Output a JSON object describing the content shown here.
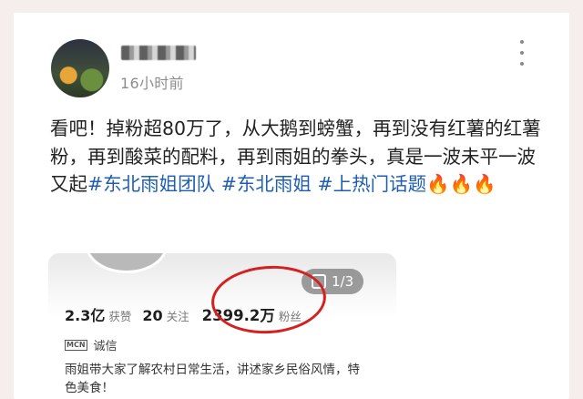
{
  "post": {
    "username": "",
    "time": "16小时前",
    "text": "看吧！掉粉超80万了，从大鹅到螃蟹，再到没有红薯的红薯粉，再到酸菜的配料，再到雨姐的拳头，真是一波未平一波又起",
    "hashtags": [
      "#东北雨姐团队",
      "#东北雨姐",
      "#上热门话题"
    ],
    "emoji": "🔥🔥🔥"
  },
  "embed": {
    "page_badge": "1/3",
    "stats": [
      {
        "value": "2.3亿",
        "label": "获赞"
      },
      {
        "value": "20",
        "label": "关注"
      },
      {
        "value": "2399.2万",
        "label": "粉丝"
      }
    ],
    "mcn_badge": "MCN",
    "verify_text": "诚信",
    "bio": "雨姐带大家了解农村日常生活，讲述家乡民俗风情，特色美食！"
  },
  "colors": {
    "hashtag": "#1f5eb0",
    "circle": "#d61f1f",
    "background": "#f6eded"
  },
  "icons": [
    "more-vertical-icon",
    "image-stack-icon",
    "fire-emoji"
  ]
}
